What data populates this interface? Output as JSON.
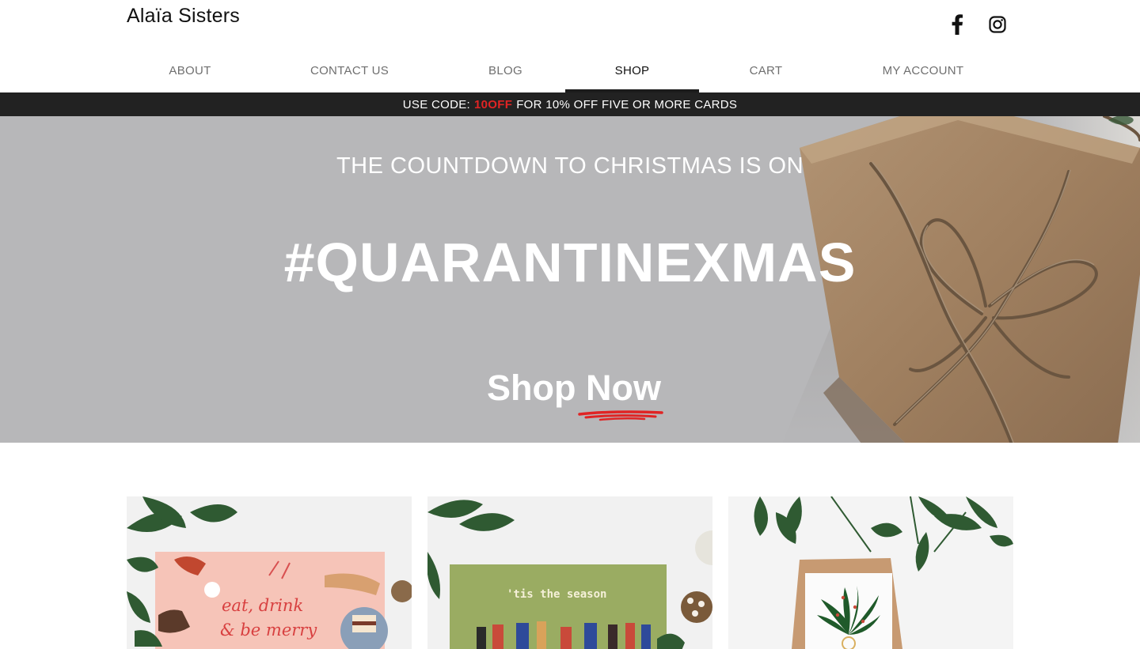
{
  "header": {
    "brand": "Alaïa Sisters",
    "social": [
      {
        "name": "facebook-icon"
      },
      {
        "name": "instagram-icon"
      }
    ]
  },
  "nav": {
    "items": [
      {
        "label": "ABOUT",
        "active": false
      },
      {
        "label": "CONTACT US",
        "active": false
      },
      {
        "label": "BLOG",
        "active": false
      },
      {
        "label": "SHOP",
        "active": true
      },
      {
        "label": "CART",
        "active": false
      },
      {
        "label": "MY ACCOUNT",
        "active": false
      }
    ]
  },
  "promo": {
    "prefix": "USE CODE:",
    "code": "10OFF",
    "suffix": "FOR 10% OFF FIVE OR MORE CARDS"
  },
  "hero": {
    "subtitle": "THE COUNTDOWN TO CHRISTMAS IS ON",
    "title": "#QUARANTINEXMAS",
    "cta": "Shop Now"
  },
  "products": [
    {
      "card_text_1": "eat, drink",
      "card_text_2": "& be merry"
    },
    {
      "card_text_1": "'tis the season"
    },
    {}
  ],
  "colors": {
    "promo_bg": "#222222",
    "promo_code": "#e02424",
    "hero_bg": "#b7b7b9",
    "accent_red": "#e02424"
  }
}
